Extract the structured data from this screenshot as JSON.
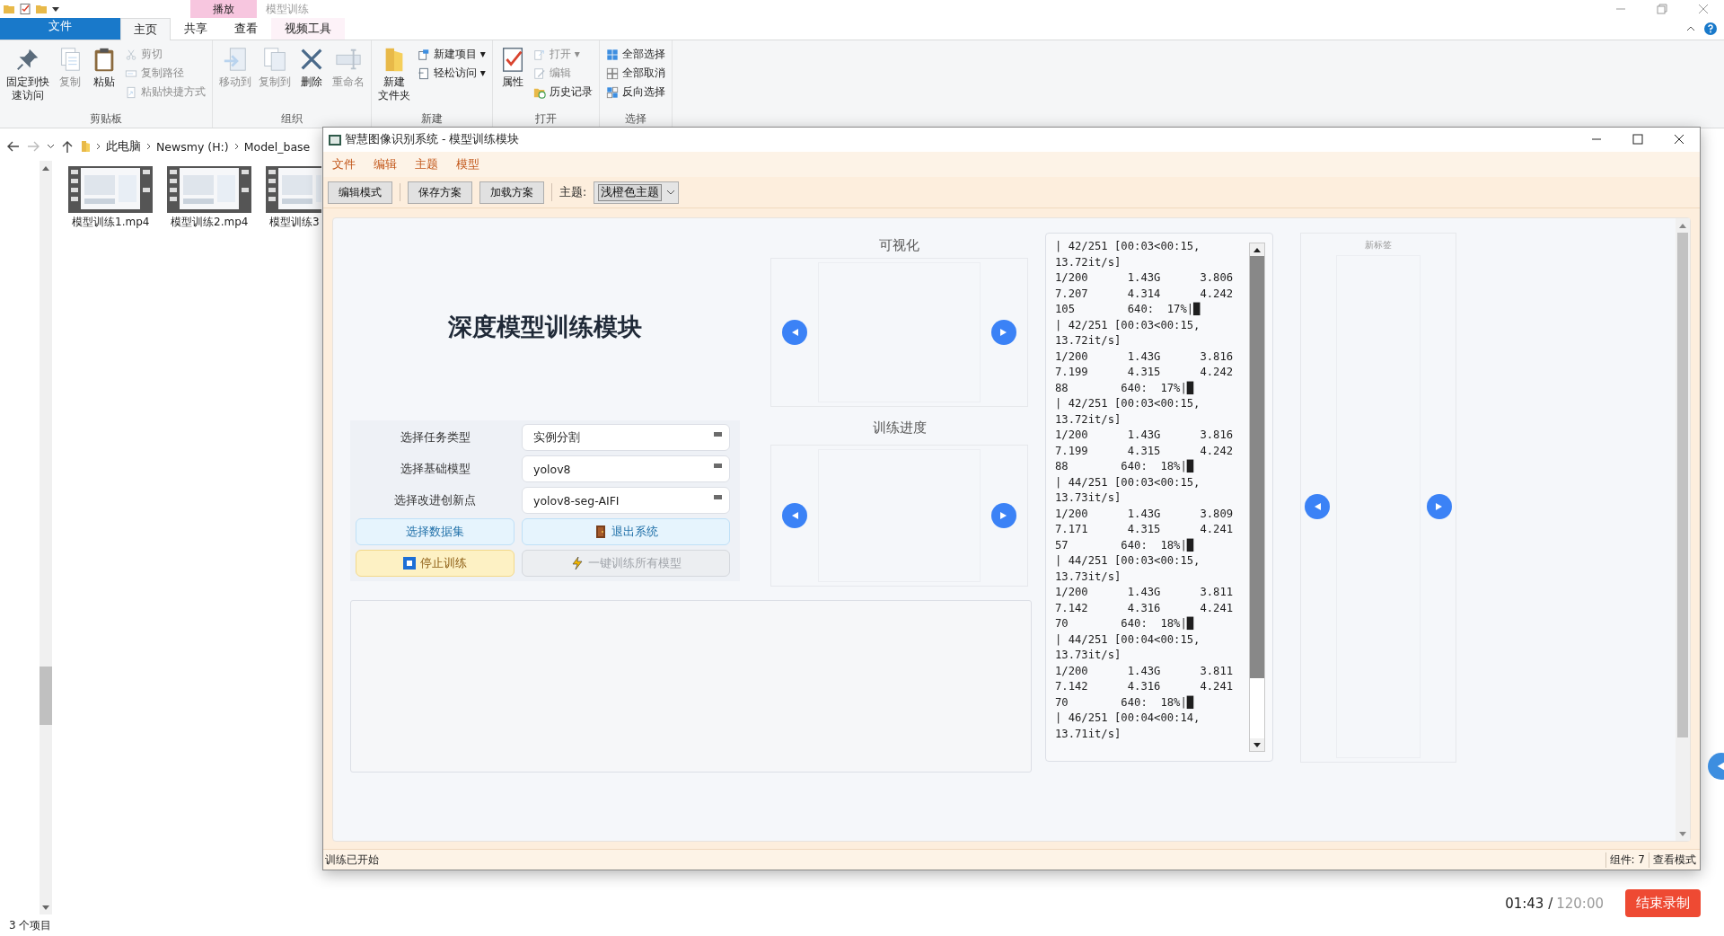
{
  "explorer": {
    "title": "模型训练",
    "context_tab": "播放",
    "tabs": [
      {
        "label": "文件",
        "selected": false,
        "kind": "file"
      },
      {
        "label": "主页",
        "selected": true,
        "kind": "tab"
      },
      {
        "label": "共享",
        "selected": false,
        "kind": "tab"
      },
      {
        "label": "查看",
        "selected": false,
        "kind": "tab"
      },
      {
        "label": "视频工具",
        "selected": false,
        "kind": "context"
      }
    ],
    "ribbon_groups": [
      {
        "label": "剪贴板",
        "items": [
          {
            "kind": "large",
            "lines": [
              "固定到快",
              "速访问"
            ],
            "disabled": false
          },
          {
            "kind": "large",
            "lines": [
              "复制"
            ],
            "disabled": true
          },
          {
            "kind": "large",
            "lines": [
              "粘贴"
            ],
            "disabled": false
          },
          {
            "kind": "stack",
            "items": [
              {
                "label": "剪切",
                "disabled": true
              },
              {
                "label": "复制路径",
                "disabled": true
              },
              {
                "label": "粘贴快捷方式",
                "disabled": true
              }
            ]
          }
        ]
      },
      {
        "label": "组织",
        "items": [
          {
            "kind": "large",
            "lines": [
              "移动到"
            ],
            "disabled": true
          },
          {
            "kind": "large",
            "lines": [
              "复制到"
            ],
            "disabled": true
          },
          {
            "kind": "large",
            "lines": [
              "删除"
            ],
            "disabled": false
          },
          {
            "kind": "large",
            "lines": [
              "重命名"
            ],
            "disabled": true
          }
        ]
      },
      {
        "label": "新建",
        "items": [
          {
            "kind": "large",
            "lines": [
              "新建",
              "文件夹"
            ],
            "disabled": false
          },
          {
            "kind": "stack",
            "items": [
              {
                "label": "新建项目 ▾",
                "disabled": false
              },
              {
                "label": "轻松访问 ▾",
                "disabled": false
              }
            ]
          }
        ]
      },
      {
        "label": "打开",
        "items": [
          {
            "kind": "large",
            "lines": [
              "属性"
            ],
            "disabled": false
          },
          {
            "kind": "stack",
            "items": [
              {
                "label": "打开 ▾",
                "disabled": true
              },
              {
                "label": "编辑",
                "disabled": true
              },
              {
                "label": "历史记录",
                "disabled": false
              }
            ]
          }
        ]
      },
      {
        "label": "选择",
        "items": [
          {
            "kind": "stack",
            "items": [
              {
                "label": "全部选择",
                "disabled": false
              },
              {
                "label": "全部取消",
                "disabled": false
              },
              {
                "label": "反向选择",
                "disabled": false
              }
            ]
          }
        ]
      }
    ],
    "address": [
      "此电脑",
      "Newsmy (H:)",
      "Model_base"
    ],
    "files": [
      {
        "name": "模型训练1.mp4"
      },
      {
        "name": "模型训练2.mp4"
      },
      {
        "name": "模型训练3"
      }
    ],
    "status": "3 个项目"
  },
  "app": {
    "title": "智慧图像识别系统 - 模型训练模块",
    "menu": [
      "文件",
      "编辑",
      "主题",
      "模型"
    ],
    "toolbar": {
      "buttons": [
        "编辑模式",
        "保存方案",
        "加载方案"
      ],
      "theme_label": "主题:",
      "theme_value": "浅橙色主题"
    },
    "heading": "深度模型训练模块",
    "form": [
      {
        "label": "选择任务类型",
        "value": "实例分割"
      },
      {
        "label": "选择基础模型",
        "value": "yolov8"
      },
      {
        "label": "选择改进创新点",
        "value": "yolov8-seg-AIFI"
      }
    ],
    "buttons": [
      {
        "label": "选择数据集",
        "kind": "info"
      },
      {
        "label": "退出系统",
        "kind": "exit"
      },
      {
        "label": "停止训练",
        "kind": "warning"
      },
      {
        "label": "一键训练所有模型",
        "kind": "muted"
      }
    ],
    "viewers": [
      {
        "title": "可视化"
      },
      {
        "title": "训练进度"
      }
    ],
    "log": [
      "| 42/251 [00:03<00:15,",
      "13.72it/s]",
      "1/200      1.43G      3.806",
      "7.207      4.314      4.242",
      "105        640:  17%|█",
      "| 42/251 [00:03<00:15,",
      "13.72it/s]",
      "1/200      1.43G      3.816",
      "7.199      4.315      4.242",
      "88        640:  17%|█",
      "| 42/251 [00:03<00:15,",
      "13.72it/s]",
      "1/200      1.43G      3.816",
      "7.199      4.315      4.242",
      "88        640:  18%|█",
      "| 44/251 [00:03<00:15,",
      "13.73it/s]",
      "1/200      1.43G      3.809",
      "7.171      4.315      4.241",
      "57        640:  18%|█",
      "| 44/251 [00:03<00:15,",
      "13.73it/s]",
      "1/200      1.43G      3.811",
      "7.142      4.316      4.241",
      "70        640:  18%|█",
      "| 44/251 [00:04<00:15,",
      "13.73it/s]",
      "1/200      1.43G      3.811",
      "7.142      4.316      4.241",
      "70        640:  18%|█",
      "| 46/251 [00:04<00:14,",
      "13.71it/s]"
    ],
    "new_tab": {
      "title": "新标签"
    },
    "status_left": "训练已开始",
    "status_right": [
      "组件: 7",
      "查看模式"
    ]
  },
  "recorder": {
    "elapsed": "01:43 /",
    "limit": "120:00",
    "button": "结束录制"
  }
}
